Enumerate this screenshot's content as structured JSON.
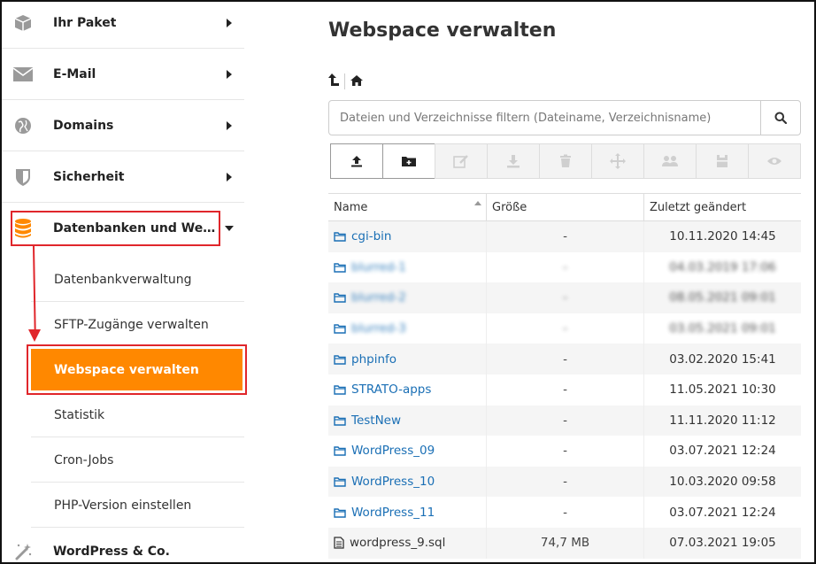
{
  "sidebar": {
    "items": [
      {
        "label": "Ihr Paket",
        "icon": "package-icon"
      },
      {
        "label": "E-Mail",
        "icon": "envelope-icon"
      },
      {
        "label": "Domains",
        "icon": "globe-icon"
      },
      {
        "label": "Sicherheit",
        "icon": "shield-icon"
      },
      {
        "label": "Datenbanken und Webspace",
        "icon": "database-icon"
      }
    ],
    "subitems": [
      {
        "label": "Datenbankverwaltung"
      },
      {
        "label": "SFTP-Zugänge verwalten"
      },
      {
        "label": "Webspace verwalten"
      },
      {
        "label": "Statistik"
      },
      {
        "label": "Cron-Jobs"
      },
      {
        "label": "PHP-Version einstellen"
      }
    ],
    "last_item": {
      "label": "WordPress & Co.",
      "icon": "magic-wand-icon"
    }
  },
  "main": {
    "title": "Webspace verwalten",
    "search": {
      "placeholder": "Dateien und Verzeichnisse filtern (Dateiname, Verzeichnisname)",
      "value": ""
    },
    "table": {
      "headers": {
        "name": "Name",
        "size": "Größe",
        "date": "Zuletzt geändert"
      },
      "rows": [
        {
          "name": "cgi-bin",
          "size": "-",
          "date": "10.11.2020 14:45",
          "type": "folder"
        },
        {
          "name": "blurred-1",
          "size": "-",
          "date": "04.03.2019 17:06",
          "type": "folder",
          "blurred": true
        },
        {
          "name": "blurred-2",
          "size": "-",
          "date": "08.05.2021 09:01",
          "type": "folder",
          "blurred": true
        },
        {
          "name": "blurred-3",
          "size": "-",
          "date": "03.05.2021 09:01",
          "type": "folder",
          "blurred": true
        },
        {
          "name": "phpinfo",
          "size": "-",
          "date": "03.02.2020 15:41",
          "type": "folder"
        },
        {
          "name": "STRATO-apps",
          "size": "-",
          "date": "11.05.2021 10:30",
          "type": "folder"
        },
        {
          "name": "TestNew",
          "size": "-",
          "date": "11.11.2020 11:12",
          "type": "folder"
        },
        {
          "name": "WordPress_09",
          "size": "-",
          "date": "03.07.2021 12:24",
          "type": "folder"
        },
        {
          "name": "WordPress_10",
          "size": "-",
          "date": "10.03.2020 09:58",
          "type": "folder"
        },
        {
          "name": "WordPress_11",
          "size": "-",
          "date": "03.07.2021 12:24",
          "type": "folder"
        },
        {
          "name": "wordpress_9.sql",
          "size": "74,7 MB",
          "date": "07.03.2021 19:05",
          "type": "file"
        }
      ]
    }
  },
  "colors": {
    "accent": "#ff8800",
    "annotation": "#e0262b",
    "link": "#1a6fb5"
  }
}
